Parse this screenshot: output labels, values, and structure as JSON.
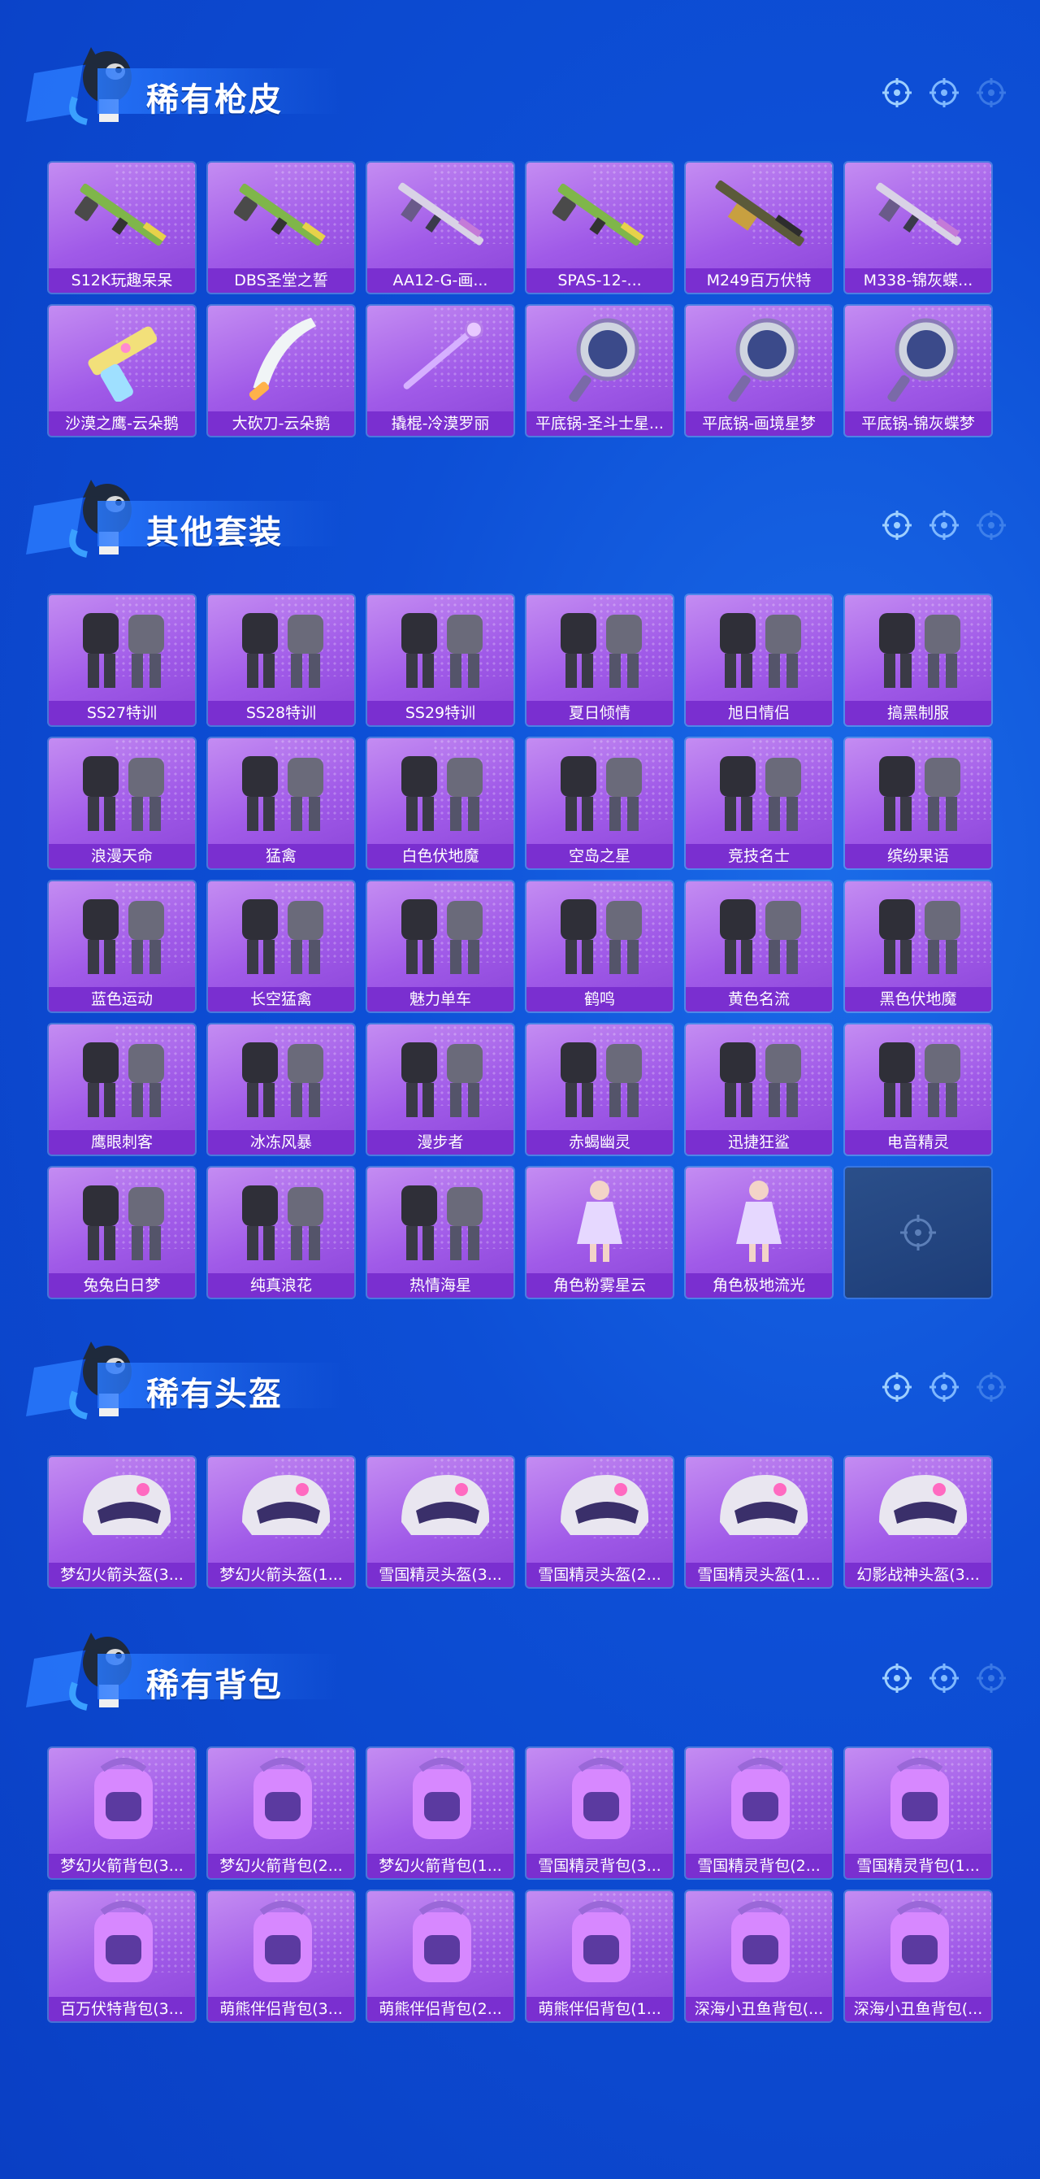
{
  "sections": [
    {
      "title": "稀有枪皮",
      "items": [
        {
          "label": "S12K玩趣呆呆",
          "icon": "shotgun-icon"
        },
        {
          "label": "DBS圣堂之誓",
          "icon": "shotgun-icon"
        },
        {
          "label": "AA12-G-画...",
          "icon": "rifle-icon"
        },
        {
          "label": "SPAS-12-...",
          "icon": "shotgun-icon"
        },
        {
          "label": "M249百万伏特",
          "icon": "machine-gun-icon"
        },
        {
          "label": "M338-锦灰蝶...",
          "icon": "rifle-icon"
        },
        {
          "label": "沙漠之鹰-云朵鹅",
          "icon": "pistol-icon"
        },
        {
          "label": "大砍刀-云朵鹅",
          "icon": "machete-icon"
        },
        {
          "label": "撬棍-冷漠罗丽",
          "icon": "crowbar-icon"
        },
        {
          "label": "平底锅-圣斗士星...",
          "icon": "pan-icon"
        },
        {
          "label": "平底锅-画境星梦",
          "icon": "pan-icon"
        },
        {
          "label": "平底锅-锦灰蝶梦",
          "icon": "pan-icon"
        }
      ]
    },
    {
      "title": "其他套装",
      "items": [
        {
          "label": "SS27特训",
          "icon": "outfit-icon"
        },
        {
          "label": "SS28特训",
          "icon": "outfit-icon"
        },
        {
          "label": "SS29特训",
          "icon": "outfit-icon"
        },
        {
          "label": "夏日倾情",
          "icon": "outfit-icon"
        },
        {
          "label": "旭日情侣",
          "icon": "outfit-icon"
        },
        {
          "label": "搞黑制服",
          "icon": "outfit-icon"
        },
        {
          "label": "浪漫天命",
          "icon": "outfit-icon"
        },
        {
          "label": "猛禽",
          "icon": "outfit-icon"
        },
        {
          "label": "白色伏地魔",
          "icon": "outfit-icon"
        },
        {
          "label": "空岛之星",
          "icon": "outfit-icon"
        },
        {
          "label": "竞技名士",
          "icon": "outfit-icon"
        },
        {
          "label": "缤纷果语",
          "icon": "outfit-icon"
        },
        {
          "label": "蓝色运动",
          "icon": "outfit-icon"
        },
        {
          "label": "长空猛禽",
          "icon": "outfit-icon"
        },
        {
          "label": "魅力单车",
          "icon": "outfit-icon"
        },
        {
          "label": "鹤鸣",
          "icon": "outfit-icon"
        },
        {
          "label": "黄色名流",
          "icon": "outfit-icon"
        },
        {
          "label": "黑色伏地魔",
          "icon": "outfit-icon"
        },
        {
          "label": "鹰眼刺客",
          "icon": "outfit-icon"
        },
        {
          "label": "冰冻风暴",
          "icon": "outfit-icon"
        },
        {
          "label": "漫步者",
          "icon": "outfit-icon"
        },
        {
          "label": "赤蝎幽灵",
          "icon": "outfit-icon"
        },
        {
          "label": "迅捷狂鲨",
          "icon": "outfit-icon"
        },
        {
          "label": "电音精灵",
          "icon": "outfit-icon"
        },
        {
          "label": "兔兔白日梦",
          "icon": "outfit-icon"
        },
        {
          "label": "纯真浪花",
          "icon": "outfit-icon"
        },
        {
          "label": "热情海星",
          "icon": "outfit-icon"
        },
        {
          "label": "角色粉雾星云",
          "icon": "character-icon"
        },
        {
          "label": "角色极地流光",
          "icon": "character-icon"
        },
        {
          "label": "",
          "icon": "empty-slot-icon",
          "empty": true
        }
      ]
    },
    {
      "title": "稀有头盔",
      "items": [
        {
          "label": "梦幻火箭头盔(3...",
          "icon": "helmet-icon"
        },
        {
          "label": "梦幻火箭头盔(1...",
          "icon": "helmet-icon"
        },
        {
          "label": "雪国精灵头盔(3...",
          "icon": "helmet-icon"
        },
        {
          "label": "雪国精灵头盔(2...",
          "icon": "helmet-icon"
        },
        {
          "label": "雪国精灵头盔(1...",
          "icon": "helmet-icon"
        },
        {
          "label": "幻影战神头盔(3...",
          "icon": "helmet-icon"
        }
      ]
    },
    {
      "title": "稀有背包",
      "items": [
        {
          "label": "梦幻火箭背包(3...",
          "icon": "backpack-icon"
        },
        {
          "label": "梦幻火箭背包(2...",
          "icon": "backpack-icon"
        },
        {
          "label": "梦幻火箭背包(1...",
          "icon": "backpack-icon"
        },
        {
          "label": "雪国精灵背包(3...",
          "icon": "backpack-icon"
        },
        {
          "label": "雪国精灵背包(2...",
          "icon": "backpack-icon"
        },
        {
          "label": "雪国精灵背包(1...",
          "icon": "backpack-icon"
        },
        {
          "label": "百万伏特背包(3...",
          "icon": "backpack-icon"
        },
        {
          "label": "萌熊伴侣背包(3...",
          "icon": "backpack-icon"
        },
        {
          "label": "萌熊伴侣背包(2...",
          "icon": "backpack-icon"
        },
        {
          "label": "萌熊伴侣背包(1...",
          "icon": "backpack-icon"
        },
        {
          "label": "深海小丑鱼背包(...",
          "icon": "backpack-icon"
        },
        {
          "label": "深海小丑鱼背包(...",
          "icon": "backpack-icon"
        }
      ]
    }
  ],
  "colors": {
    "card": "#a05ae8",
    "label_bar": "#7a2fd0",
    "background": "#0d4fd6"
  }
}
